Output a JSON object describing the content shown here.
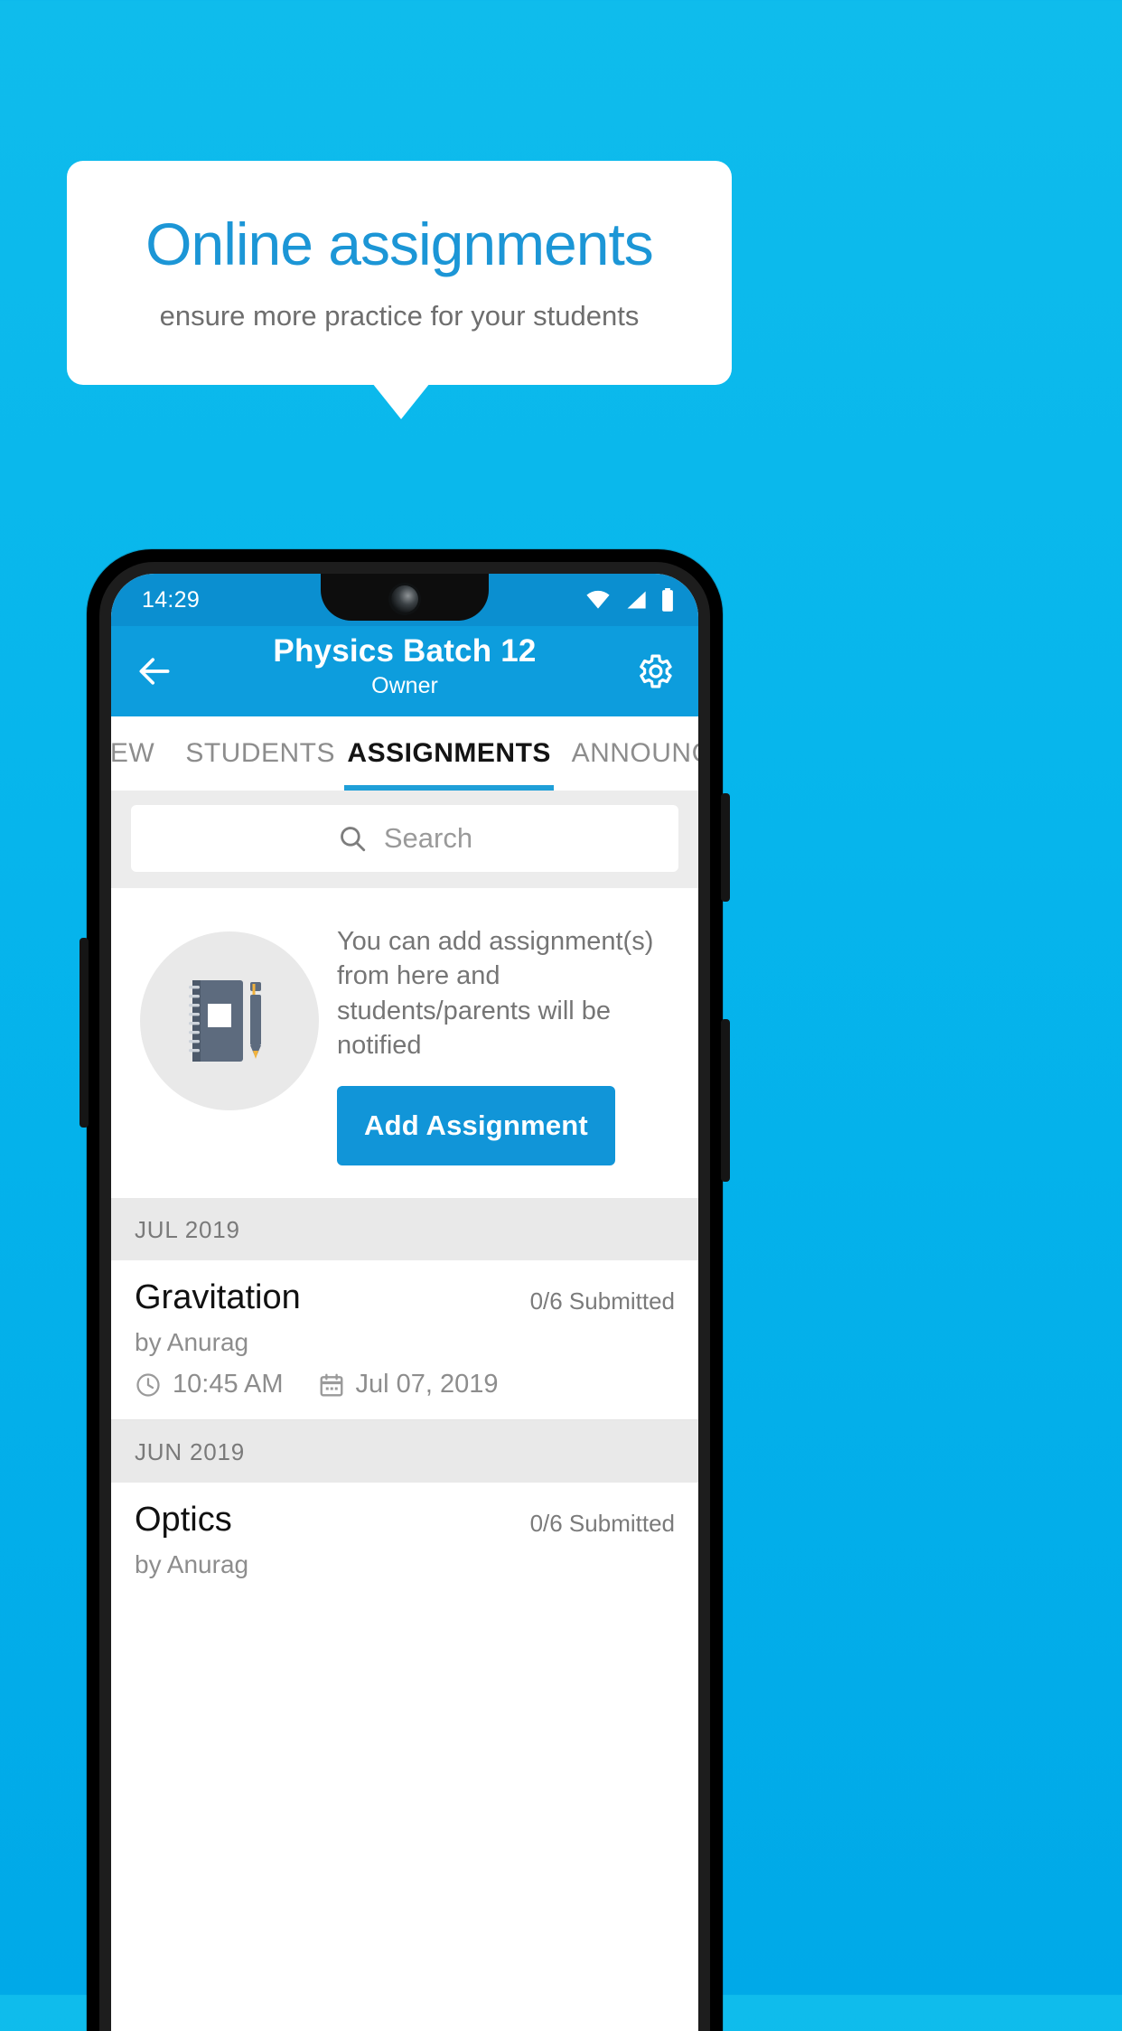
{
  "theme": {
    "background_blue": "#06b5ec",
    "brand_blue": "#1195d8",
    "appbar_blue": "#0d9ddd",
    "statusbar_blue": "#0b8fd0",
    "section_grey": "#e9e9e9"
  },
  "callout": {
    "title": "Online assignments",
    "subtitle": "ensure more practice for your students"
  },
  "phone": {
    "statusbar": {
      "time": "14:29",
      "icons": [
        "wifi-icon",
        "signal-icon",
        "battery-icon"
      ]
    },
    "appbar": {
      "back_icon": "back-arrow-icon",
      "title": "Physics Batch 12",
      "subtitle": "Owner",
      "settings_icon": "gear-icon"
    },
    "tabs": [
      {
        "label": "IEW",
        "active": false
      },
      {
        "label": "STUDENTS",
        "active": false
      },
      {
        "label": "ASSIGNMENTS",
        "active": true
      },
      {
        "label": "ANNOUNCEM",
        "active": false
      }
    ],
    "search": {
      "icon": "search-icon",
      "placeholder": "Search",
      "value": ""
    },
    "empty_state": {
      "illustration": "notebook-and-pen-icon",
      "message": "You can add assignment(s) from here and students/parents will be notified",
      "button_label": "Add Assignment"
    },
    "sections": [
      {
        "header": "JUL 2019",
        "assignments": [
          {
            "title": "Gravitation",
            "submitted": "0/6 Submitted",
            "author": "by Anurag",
            "time_icon": "clock-icon",
            "time": "10:45 AM",
            "date_icon": "calendar-icon",
            "date": "Jul 07, 2019"
          }
        ]
      },
      {
        "header": "JUN 2019",
        "assignments": [
          {
            "title": "Optics",
            "submitted": "0/6 Submitted",
            "author": "by Anurag",
            "time_icon": "clock-icon",
            "time": "",
            "date_icon": "calendar-icon",
            "date": ""
          }
        ]
      }
    ]
  }
}
